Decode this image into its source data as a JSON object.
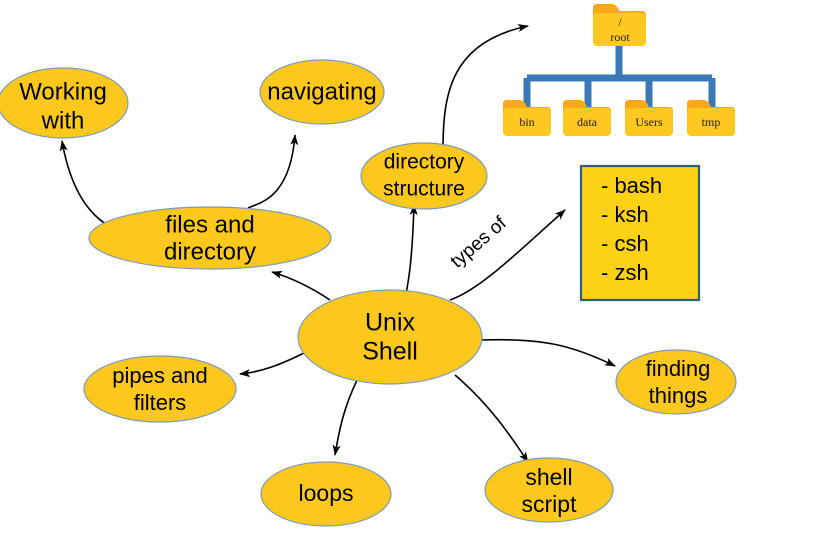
{
  "diagram": {
    "title": "Unix Shell mind map",
    "background": "#ffffff",
    "colors": {
      "node_fill": "#FCC81E",
      "node_stroke": "#7E9BB5",
      "edge": "#000000",
      "tree_link": "#3B79B6",
      "folder_body": "#FDC81F",
      "folder_tab": "#F7A81B",
      "box_fill": "#FCD116",
      "box_stroke": "#2F5D7C"
    },
    "center": {
      "label_line1": "Unix",
      "label_line2": "Shell"
    },
    "nodes": [
      {
        "id": "working-with",
        "line1": "Working",
        "line2": "with"
      },
      {
        "id": "navigating",
        "line1": "navigating",
        "line2": ""
      },
      {
        "id": "files-and-directory",
        "line1": "files and",
        "line2": "directory"
      },
      {
        "id": "directory-structure",
        "line1": "directory",
        "line2": "structure"
      },
      {
        "id": "pipes-and-filters",
        "line1": "pipes and",
        "line2": "filters"
      },
      {
        "id": "loops",
        "line1": "loops",
        "line2": ""
      },
      {
        "id": "shell-script",
        "line1": "shell",
        "line2": "script"
      },
      {
        "id": "finding-things",
        "line1": "finding",
        "line2": "things"
      }
    ],
    "edge_labels": [
      {
        "id": "types-of",
        "text": "types of"
      }
    ],
    "shell_types_box": {
      "items": [
        "- bash",
        "- ksh",
        "- csh",
        "- zsh"
      ]
    },
    "folder_tree": {
      "root": {
        "slash": "/",
        "name": "root"
      },
      "children": [
        {
          "name": "bin"
        },
        {
          "name": "data"
        },
        {
          "name": "Users"
        },
        {
          "name": "tmp"
        }
      ]
    }
  }
}
